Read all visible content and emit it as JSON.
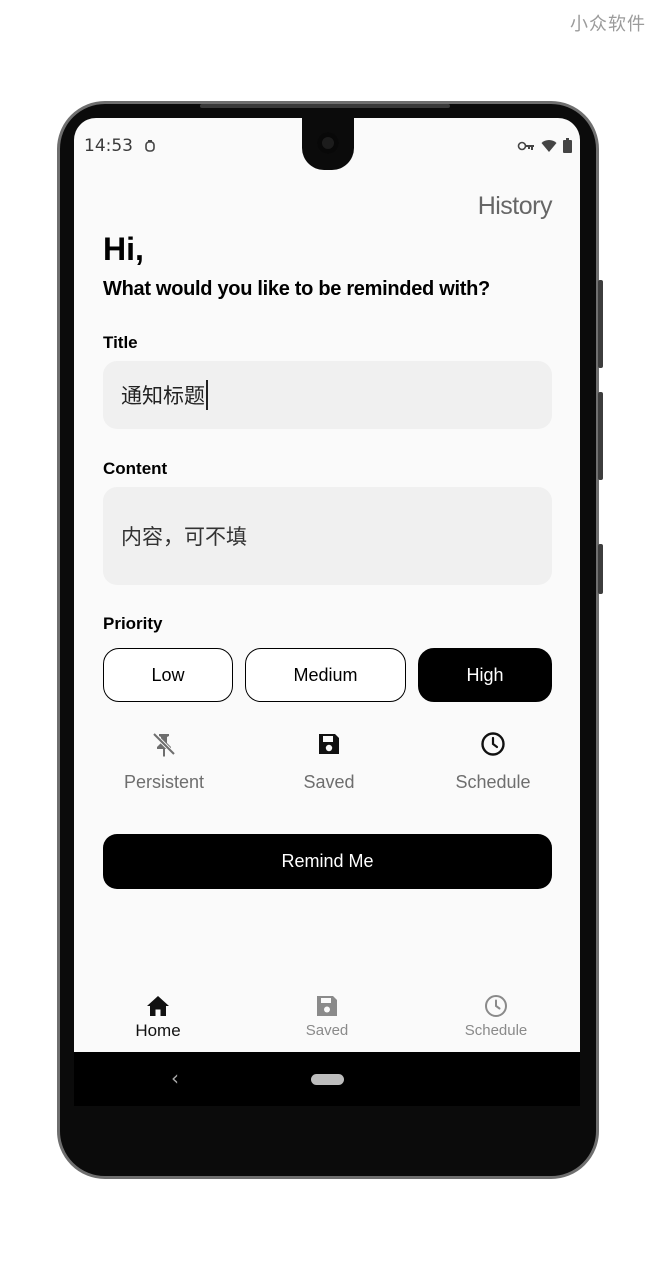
{
  "watermark": "小众软件",
  "status_bar": {
    "time": "14:53",
    "icons": [
      "alarm-icon",
      "vpn-key-icon",
      "wifi-icon",
      "battery-icon"
    ]
  },
  "header": {
    "history_label": "History",
    "greeting": "Hi,",
    "subheading": "What would you like to be reminded with?"
  },
  "form": {
    "title_label": "Title",
    "title_value": "通知标题",
    "content_label": "Content",
    "content_placeholder": "内容，可不填",
    "priority_label": "Priority",
    "priority_options": [
      "Low",
      "Medium",
      "High"
    ],
    "priority_selected": "High"
  },
  "options": [
    {
      "icon": "pin-off-icon",
      "label": "Persistent"
    },
    {
      "icon": "save-icon",
      "label": "Saved"
    },
    {
      "icon": "clock-icon",
      "label": "Schedule"
    }
  ],
  "remind_button": "Remind Me",
  "bottom_nav": {
    "active": "Home",
    "items": [
      {
        "icon": "home-icon",
        "label": "Home"
      },
      {
        "icon": "save-icon",
        "label": "Saved"
      },
      {
        "icon": "clock-icon",
        "label": "Schedule"
      }
    ]
  },
  "system_nav": {
    "back_glyph": "‹"
  },
  "colors": {
    "primary": "#000000",
    "background": "#fafafa",
    "field_background": "#f0f0f0",
    "muted_text": "#6e6e6e"
  }
}
